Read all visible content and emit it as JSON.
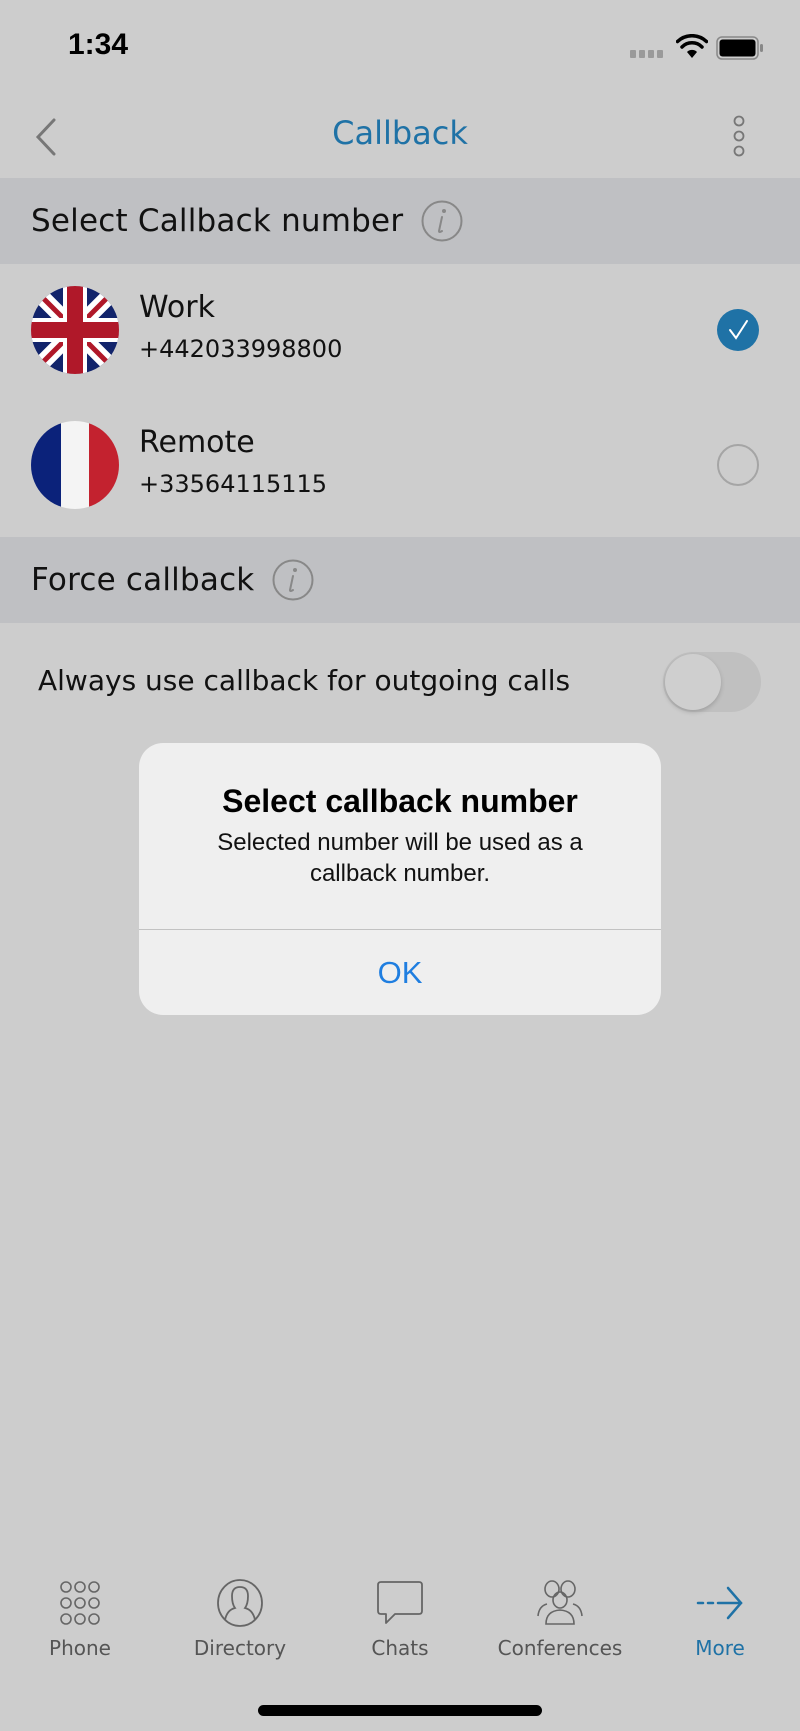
{
  "status_bar": {
    "time": "1:34",
    "signal_icon": "cellular-signal-icon",
    "wifi_icon": "wifi-icon",
    "battery_icon": "battery-icon"
  },
  "nav": {
    "title": "Callback",
    "back_icon": "chevron-left-icon",
    "menu_icon": "more-vertical-icon"
  },
  "sections": {
    "callback_number": {
      "title": "Select Callback number",
      "info_icon": "info-icon"
    },
    "force_callback": {
      "title": "Force callback",
      "info_icon": "info-icon"
    }
  },
  "numbers": [
    {
      "label": "Work",
      "number": "+442033998800",
      "flag": "uk-flag-icon",
      "selected": true
    },
    {
      "label": "Remote",
      "number": "+33564115115",
      "flag": "france-flag-icon",
      "selected": false
    }
  ],
  "force_toggle": {
    "label": "Always use callback for outgoing calls",
    "enabled": false
  },
  "alert": {
    "title": "Select callback number",
    "message": "Selected number will be used as a callback number.",
    "ok_label": "OK"
  },
  "tab_bar": {
    "tabs": [
      {
        "label": "Phone",
        "icon": "dialpad-icon",
        "active": false
      },
      {
        "label": "Directory",
        "icon": "contact-icon",
        "active": false
      },
      {
        "label": "Chats",
        "icon": "chat-bubble-icon",
        "active": false
      },
      {
        "label": "Conferences",
        "icon": "group-icon",
        "active": false
      },
      {
        "label": "More",
        "icon": "arrow-right-icon",
        "active": true
      }
    ]
  },
  "colors": {
    "accent": "#1f72a6",
    "alert_button": "#1f7ee0",
    "background": "#cdcdcd",
    "section_header": "#bfc0c3"
  }
}
